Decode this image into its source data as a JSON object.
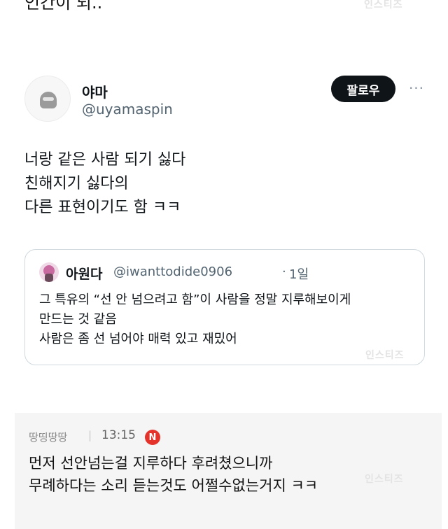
{
  "top": {
    "text": "인간이 되.."
  },
  "watermarks": [
    "인스티즈",
    "인스티즈",
    "인스티즈"
  ],
  "tweet": {
    "display_name": "야마",
    "handle": "@uyamaspin",
    "follow_label": "팔로우",
    "more_label": "···",
    "body_lines": [
      "너랑 같은 사람 되기 싫다",
      "친해지기 싫다의",
      "다른 표현이기도 함 ㅋㅋ"
    ]
  },
  "quote": {
    "display_name": "아원다",
    "handle": "@iwanttodide0906",
    "dot": "·",
    "time": "1일",
    "lines": [
      "그 특유의 “선 안 넘으려고 함”이 사람을 정말 지루해보이게",
      "만드는 것 같음",
      "사람은 좀 선 넘어야 매력 있고 재밌어"
    ]
  },
  "comment": {
    "author": "땅띵땅땅",
    "separator": "|",
    "time": "13:15",
    "badge": "N",
    "badge_color": "#e4332b",
    "lines": [
      "먼저 선안넘는걸 지루하다 후려쳤으니까",
      "무례하다는 소리 듣는것도 어쩔수없는거지 ㅋㅋ"
    ]
  }
}
